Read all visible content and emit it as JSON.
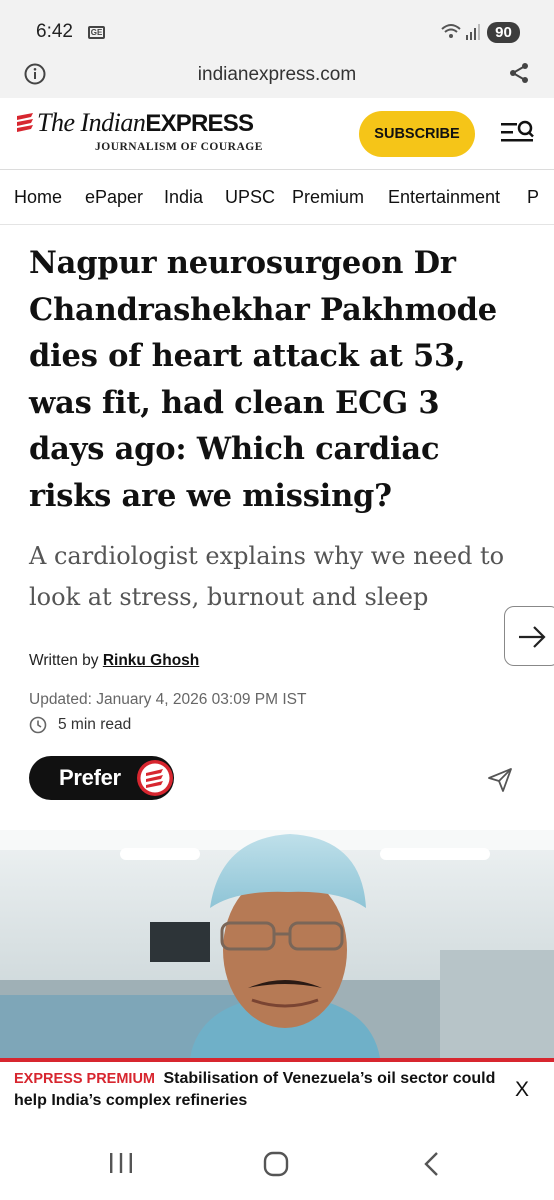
{
  "status_bar": {
    "time": "6:42",
    "ge_badge": "GE",
    "battery": "90"
  },
  "browser": {
    "url": "indianexpress.com",
    "icons": [
      "info-icon",
      "share-icon"
    ]
  },
  "header": {
    "logo_text_1": "The Indian",
    "logo_text_2": "EXPRESS",
    "tagline": "JOURNALISM OF COURAGE",
    "subscribe_label": "SUBSCRIBE",
    "brand_color": "#d7262f",
    "accent_color": "#f5c518"
  },
  "nav": {
    "items": [
      "Home",
      "ePaper",
      "India",
      "UPSC",
      "Premium",
      "Entertainment",
      "P"
    ]
  },
  "article": {
    "headline_lines": [
      "Nagpur neurosurgeon Dr",
      "Chandrashekhar Pakhmode",
      "dies of heart attack at 53,",
      "was fit, had clean ECG 3",
      "days ago: Which cardiac",
      "risks are we missing?"
    ],
    "subhead_lines": [
      "A cardiologist explains why we need to",
      "look at stress, burnout and sleep"
    ],
    "byline_prefix": "Written by",
    "author": "Rinku Ghosh",
    "updated": "Updated: January 4, 2026 03:09 PM IST",
    "read_time": "5 min read",
    "prefer_label": "Prefer"
  },
  "premium_banner": {
    "tag": "EXPRESS PREMIUM",
    "text": "Stabilisation of Venezuela’s oil sector could help India’s complex refineries",
    "close": "X"
  }
}
